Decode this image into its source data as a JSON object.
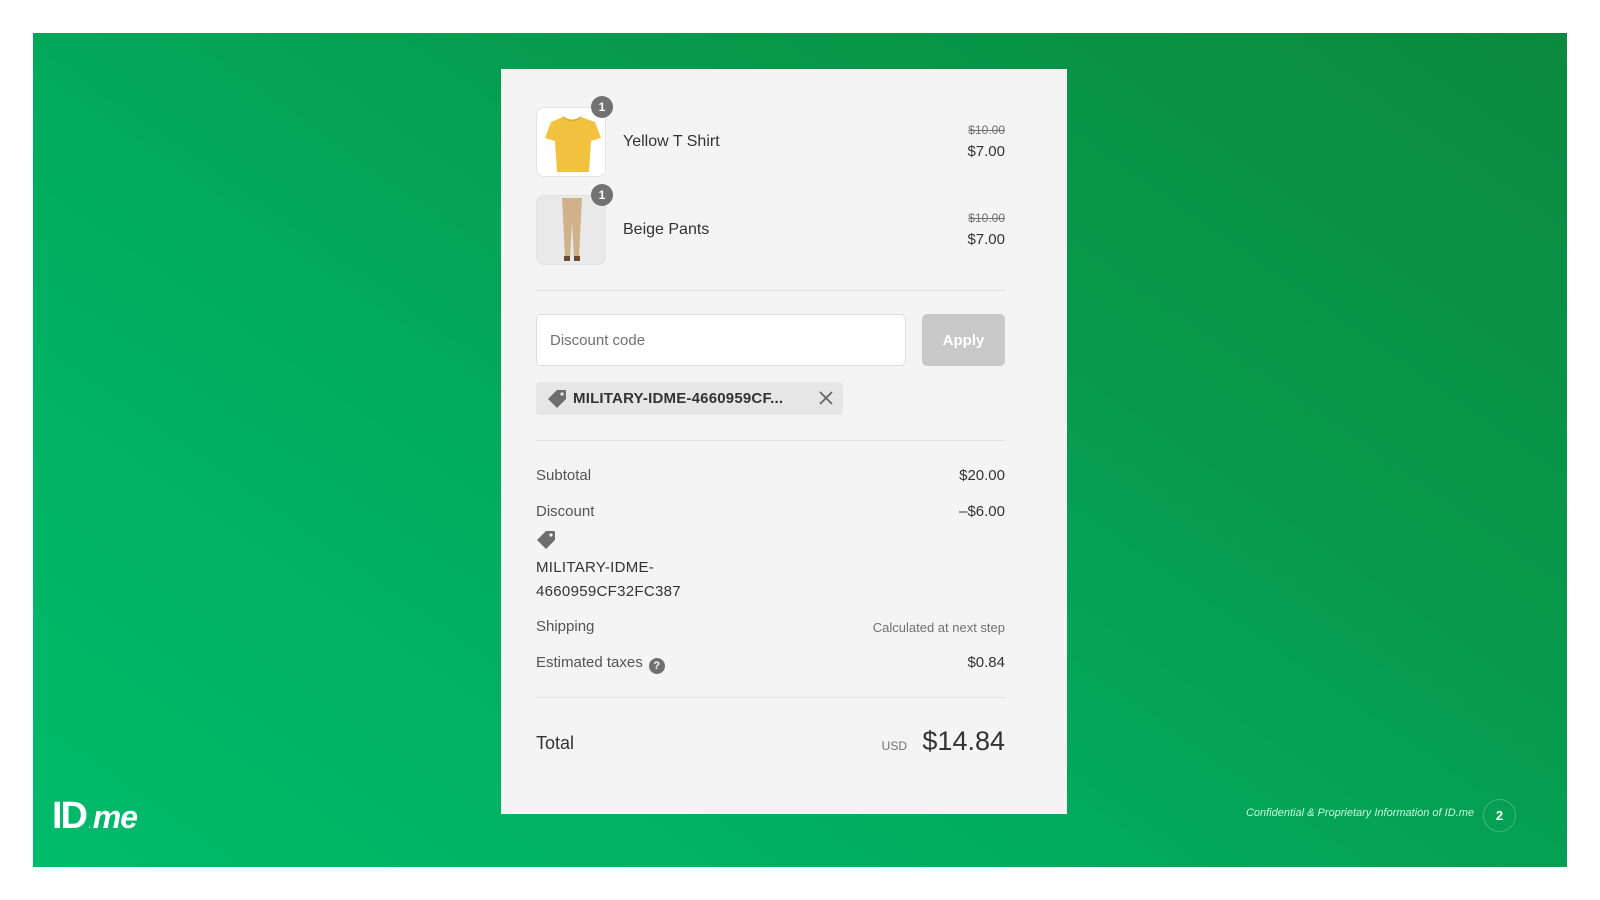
{
  "colors": {
    "background_gradient_start": "#00ba6c",
    "background_gradient_end": "#0b8a3f",
    "card_background": "#f4f4f4",
    "apply_button": "#c8c8c8",
    "text_primary": "#333333",
    "text_secondary": "#707070"
  },
  "cart": {
    "items": [
      {
        "name": "Yellow T Shirt",
        "quantity": "1",
        "original_price": "$10.00",
        "price": "$7.00",
        "image_icon": "yellow-tshirt-image"
      },
      {
        "name": "Beige Pants",
        "quantity": "1",
        "original_price": "$10.00",
        "price": "$7.00",
        "image_icon": "beige-pants-image"
      }
    ]
  },
  "discount_form": {
    "placeholder": "Discount code",
    "value": "",
    "apply_label": "Apply",
    "applied_code_short": "MILITARY-IDME-4660959CF...",
    "tag_icon": "tag-icon",
    "remove_icon": "close-icon"
  },
  "summary": {
    "subtotal_label": "Subtotal",
    "subtotal_value": "$20.00",
    "discount_label": "Discount",
    "discount_value": "–$6.00",
    "discount_code_line1": "MILITARY-IDME-",
    "discount_code_line2": "4660959CF32FC387",
    "shipping_label": "Shipping",
    "shipping_value": "Calculated at next step",
    "taxes_label": "Estimated taxes",
    "taxes_help": "?",
    "taxes_value": "$0.84",
    "total_label": "Total",
    "total_currency": "USD",
    "total_value": "$14.84"
  },
  "footer": {
    "logo_id": "ID",
    "logo_dot": ".",
    "logo_me": "me",
    "confidential": "Confidential & Proprietary Information of ID.me",
    "page_number": "2"
  }
}
